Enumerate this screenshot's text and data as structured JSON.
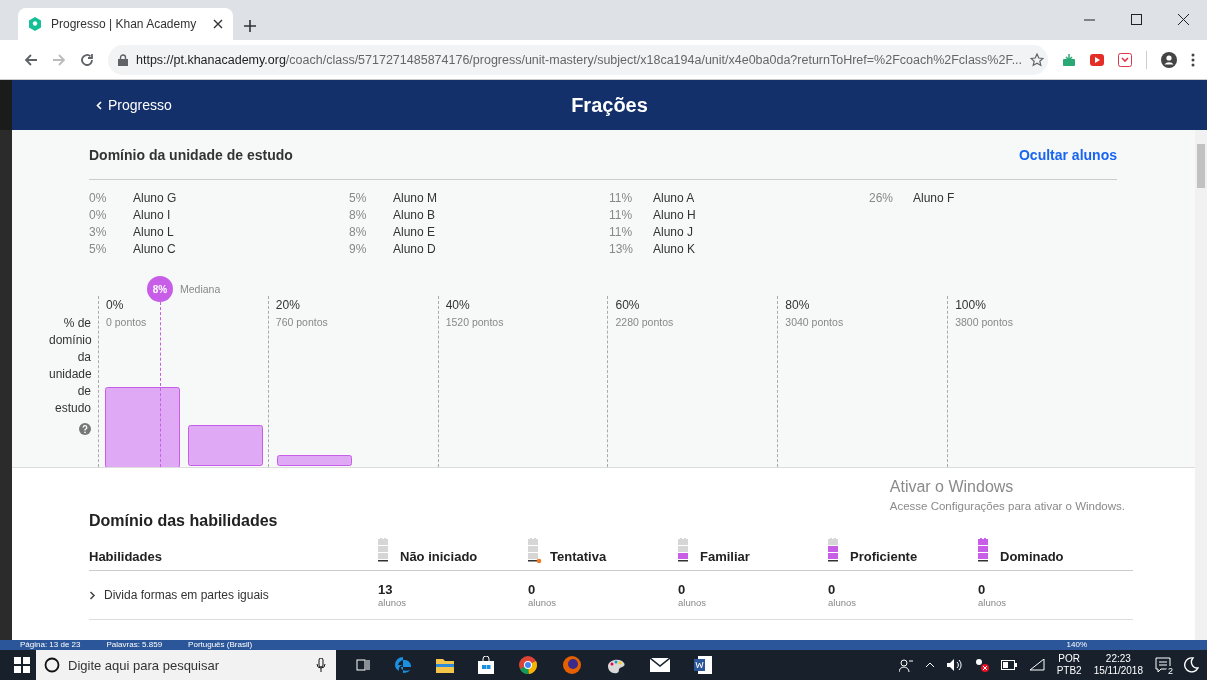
{
  "browser": {
    "tab": {
      "title": "Progresso | Khan Academy",
      "selected": true
    },
    "url_domain": "https://pt.khanacademy.org",
    "url_path": "/coach/class/5717271485874176/progress/unit-mastery/subject/x18ca194a/unit/x4e0ba0da?returnToHref=%2Fcoach%2Fclass%2F..."
  },
  "header": {
    "back_link": "Progresso",
    "title": "Frações"
  },
  "unit_mastery": {
    "title": "Domínio da unidade de estudo",
    "toggle_link": "Ocultar alunos",
    "student_columns": [
      [
        {
          "percent": "0%",
          "name": "Aluno G"
        },
        {
          "percent": "0%",
          "name": "Aluno I"
        },
        {
          "percent": "3%",
          "name": "Aluno L"
        },
        {
          "percent": "5%",
          "name": "Aluno C"
        }
      ],
      [
        {
          "percent": "5%",
          "name": "Aluno M"
        },
        {
          "percent": "8%",
          "name": "Aluno B"
        },
        {
          "percent": "8%",
          "name": "Aluno E"
        },
        {
          "percent": "9%",
          "name": "Aluno D"
        }
      ],
      [
        {
          "percent": "11%",
          "name": "Aluno A"
        },
        {
          "percent": "11%",
          "name": "Aluno H"
        },
        {
          "percent": "11%",
          "name": "Aluno J"
        },
        {
          "percent": "13%",
          "name": "Aluno K"
        }
      ],
      [
        {
          "percent": "26%",
          "name": "Aluno F"
        }
      ]
    ],
    "axis_label": "% de domínio da unidade de estudo",
    "median": {
      "value": "8%",
      "label": "Mediana"
    },
    "ticks": [
      {
        "percent": "0%",
        "points": "0 pontos"
      },
      {
        "percent": "20%",
        "points": "760 pontos"
      },
      {
        "percent": "40%",
        "points": "1520 pontos"
      },
      {
        "percent": "60%",
        "points": "2280 pontos"
      },
      {
        "percent": "80%",
        "points": "3040 pontos"
      },
      {
        "percent": "100%",
        "points": "3800 pontos"
      }
    ]
  },
  "skills": {
    "title": "Domínio das habilidades",
    "column_header": "Habilidades",
    "levels": [
      {
        "kind": "not_started",
        "label": "Não iniciado"
      },
      {
        "kind": "attempted",
        "label": "Tentativa"
      },
      {
        "kind": "familiar",
        "label": "Familiar"
      },
      {
        "kind": "proficient",
        "label": "Proficiente"
      },
      {
        "kind": "mastered",
        "label": "Dominado"
      }
    ],
    "rows": [
      {
        "name": "Divida formas em partes iguais",
        "expanded": false,
        "counts": [
          {
            "count": "13",
            "unit": "alunos"
          },
          {
            "count": "0",
            "unit": "alunos"
          },
          {
            "count": "0",
            "unit": "alunos"
          },
          {
            "count": "0",
            "unit": "alunos"
          },
          {
            "count": "0",
            "unit": "alunos"
          }
        ]
      }
    ]
  },
  "activation_notice": {
    "title": "Ativar o Windows",
    "text": "Acesse Configurações para ativar o Windows."
  },
  "word_status_bar": [
    "Página: 13 de 23",
    "Palavras: 5.859",
    "Português (Brasil)",
    "140%"
  ],
  "taskbar": {
    "search_placeholder": "Digite aqui para pesquisar",
    "language": "POR",
    "layout": "PTB2",
    "time": "22:23",
    "date": "15/11/2018",
    "notifications": "2"
  }
}
